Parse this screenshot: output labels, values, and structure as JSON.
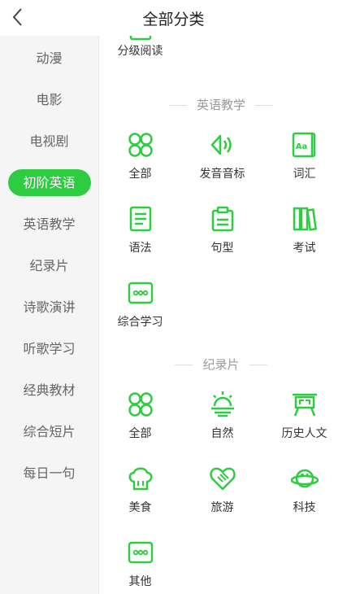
{
  "header": {
    "title": "全部分类"
  },
  "sidebar": {
    "items": [
      "动漫",
      "电影",
      "电视剧",
      "初阶英语",
      "英语教学",
      "纪录片",
      "诗歌演讲",
      "听歌学习",
      "经典教材",
      "综合短片",
      "每日一句"
    ],
    "active_index": 3
  },
  "content": {
    "top_item": {
      "label": "分级阅读",
      "icon": "reading-icon"
    },
    "sections": [
      {
        "title": "英语教学",
        "items": [
          {
            "label": "全部",
            "icon": "grid-icon"
          },
          {
            "label": "发音音标",
            "icon": "speaker-icon"
          },
          {
            "label": "词汇",
            "icon": "dictionary-icon"
          },
          {
            "label": "语法",
            "icon": "notebook-icon"
          },
          {
            "label": "句型",
            "icon": "clipboard-icon"
          },
          {
            "label": "考试",
            "icon": "books-icon"
          },
          {
            "label": "综合学习",
            "icon": "more-icon"
          }
        ]
      },
      {
        "title": "纪录片",
        "items": [
          {
            "label": "全部",
            "icon": "grid-icon"
          },
          {
            "label": "自然",
            "icon": "sunrise-icon"
          },
          {
            "label": "历史人文",
            "icon": "monument-icon"
          },
          {
            "label": "美食",
            "icon": "chef-hat-icon"
          },
          {
            "label": "旅游",
            "icon": "handshake-heart-icon"
          },
          {
            "label": "科技",
            "icon": "planet-icon"
          },
          {
            "label": "其他",
            "icon": "more-icon"
          }
        ]
      }
    ]
  },
  "colors": {
    "accent": "#2ecc40",
    "sidebar_bg": "#f5f5f5"
  }
}
